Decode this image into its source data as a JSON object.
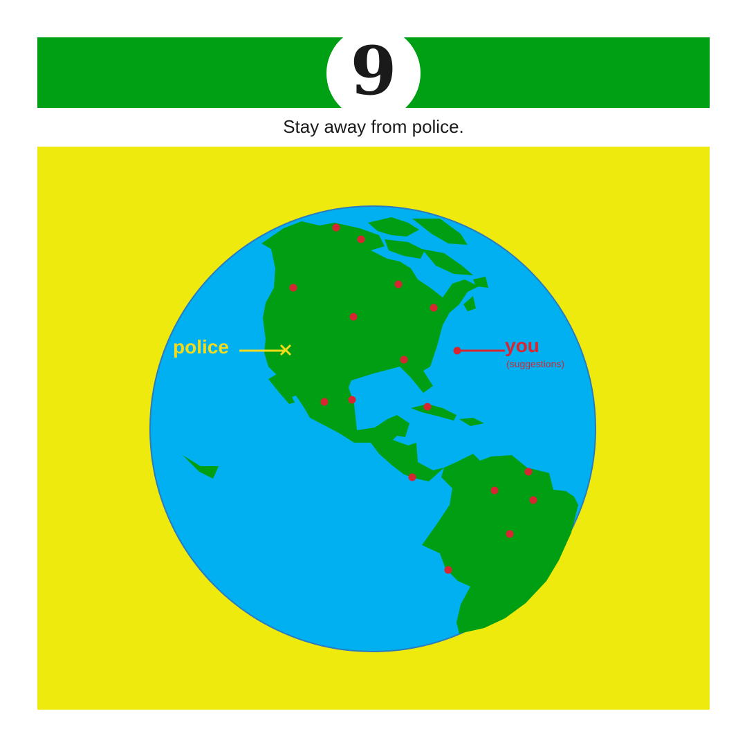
{
  "header": {
    "number": "9"
  },
  "headline": "Stay away from police.",
  "labels": {
    "police": "police",
    "you": "you",
    "suggestions": "(suggestions)"
  },
  "colors": {
    "header_green": "#00a014",
    "panel_yellow": "#eeea0e",
    "ocean_blue": "#00b0f0",
    "land_green": "#009e12",
    "dot_red": "#d72631",
    "police_yellow": "#f2dc1c"
  },
  "icons": {
    "police_marker": "x-mark-icon",
    "location_dots": "red-dot-icon"
  }
}
